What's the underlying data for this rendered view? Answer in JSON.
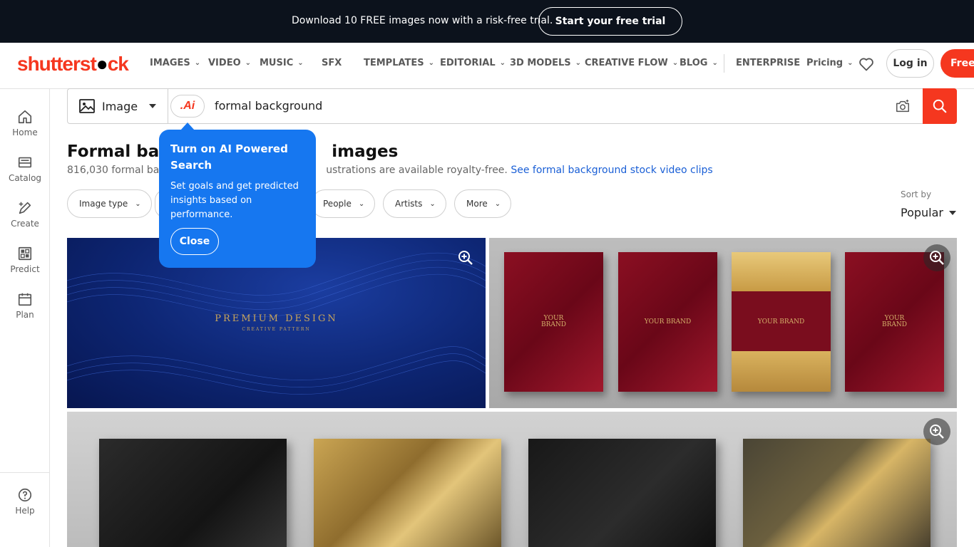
{
  "promo": {
    "text": "Download 10 FREE images now with a risk-free trial.",
    "cta": "Start your free trial"
  },
  "nav": {
    "logo_a": "shutterst",
    "logo_b": "ck",
    "items": [
      {
        "label": "IMAGES",
        "dropdown": true
      },
      {
        "label": "VIDEO",
        "dropdown": true
      },
      {
        "label": "MUSIC",
        "dropdown": true
      },
      {
        "label": "SFX",
        "dropdown": false
      },
      {
        "label": "TEMPLATES",
        "dropdown": true
      },
      {
        "label": "EDITORIAL",
        "dropdown": true
      },
      {
        "label": "3D MODELS",
        "dropdown": true
      },
      {
        "label": "CREATIVE FLOW",
        "dropdown": true
      },
      {
        "label": "BLOG",
        "dropdown": true
      },
      {
        "label": "ENTERPRISE",
        "dropdown": false
      },
      {
        "label": "Pricing",
        "dropdown": true
      }
    ],
    "login": "Log in",
    "free_trial": "Free t"
  },
  "sidebar": {
    "items": [
      {
        "label": "Home",
        "icon": "home-icon"
      },
      {
        "label": "Catalog",
        "icon": "catalog-icon"
      },
      {
        "label": "Create",
        "icon": "create-icon"
      },
      {
        "label": "Predict",
        "icon": "predict-icon"
      },
      {
        "label": "Plan",
        "icon": "calendar-icon"
      }
    ],
    "help": "Help"
  },
  "search": {
    "type": "Image",
    "ai_label": ".Ai",
    "query": "formal background"
  },
  "results": {
    "title": "Formal background images",
    "title_visible": "Formal back",
    "title_tail": "images",
    "subtitle_lead": "816,030 formal back",
    "subtitle_mid": "ustrations are available royalty-free.",
    "subtitle_link": "See formal background stock video clips"
  },
  "filters": [
    {
      "label": "Image type"
    },
    {
      "label": "People"
    },
    {
      "label": "Artists"
    },
    {
      "label": "More"
    }
  ],
  "sort": {
    "label": "Sort by",
    "value": "Popular"
  },
  "images": {
    "img1_title": "PREMIUM DESIGN",
    "img1_sub": "CREATIVE PATTERN",
    "img2_cards": [
      "YOUR\nBRAND",
      "YOUR BRAND",
      "YOUR BRAND",
      "YOUR\nBRAND"
    ]
  },
  "tooltip": {
    "title": "Turn on AI Powered Search",
    "body": "Set goals and get predicted insights based on performance.",
    "close": "Close"
  },
  "colors": {
    "brand": "#f5371f",
    "tooltip": "#1677f0",
    "promo_bg": "#0c121c",
    "link": "#1a5fd6"
  }
}
